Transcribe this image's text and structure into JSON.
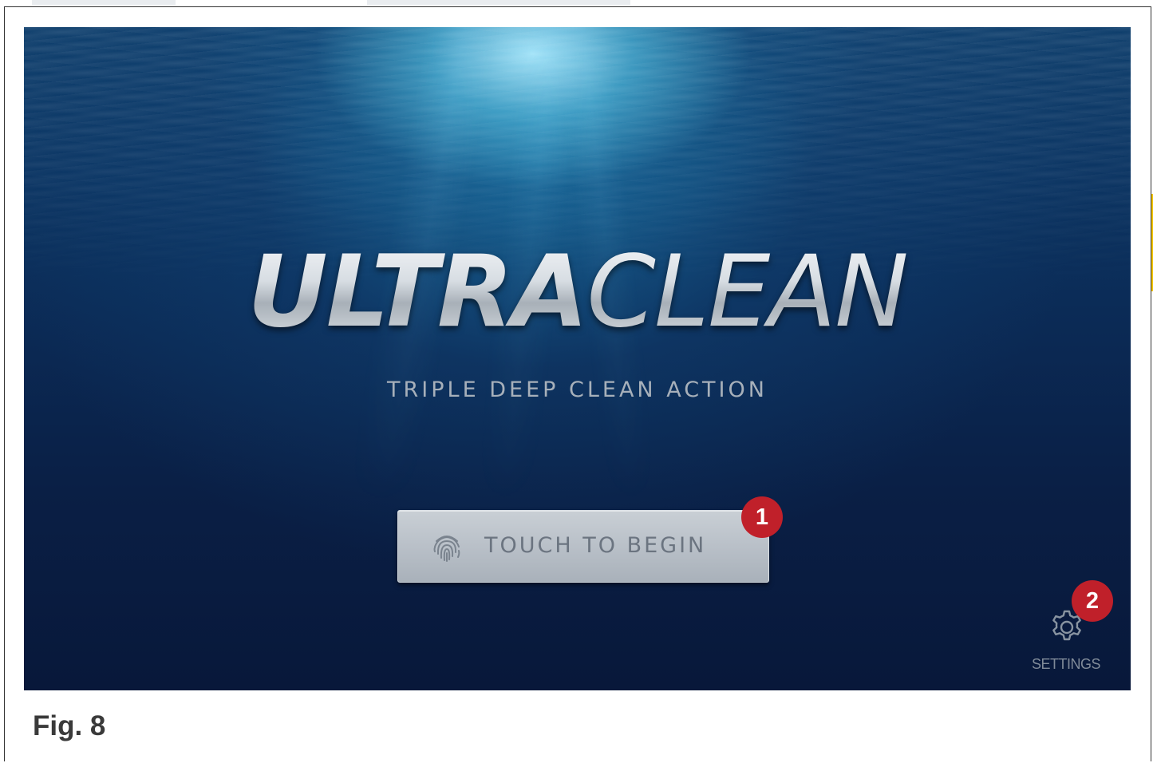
{
  "app": {
    "logo_bold": "ULTRA",
    "logo_light": "CLEAN",
    "tagline": "TRIPLE DEEP CLEAN ACTION"
  },
  "start_button": {
    "label": "TOUCH TO BEGIN",
    "icon": "fingerprint-icon"
  },
  "settings": {
    "label": "SETTINGS",
    "icon": "gear-icon"
  },
  "callouts": [
    "1",
    "2"
  ],
  "figure": {
    "caption": "Fig. 8"
  },
  "colors": {
    "callout": "#c0202a",
    "water_top": "#0f3f6d",
    "water_bottom": "#08183a",
    "button": "#b9c0c8"
  }
}
